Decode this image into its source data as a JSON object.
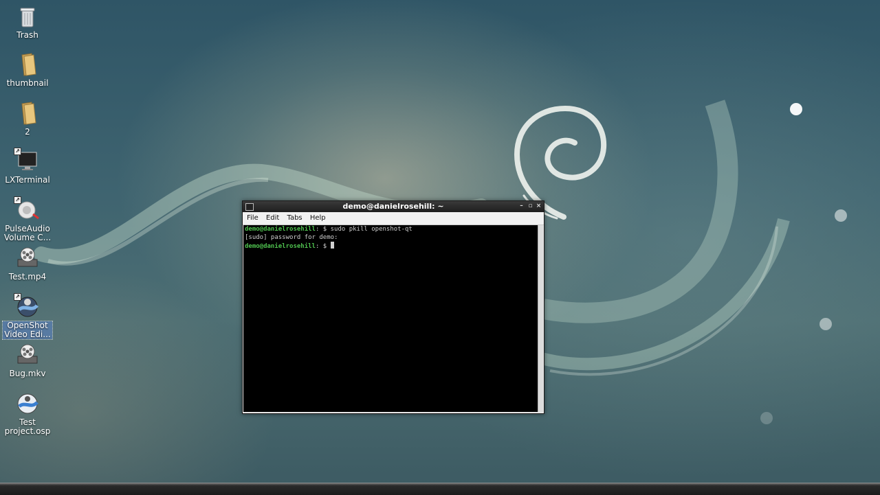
{
  "desktop": {
    "icons": [
      {
        "label": "Trash",
        "icon": "trash-icon"
      },
      {
        "label": "thumbnail",
        "icon": "folder-icon"
      },
      {
        "label": "2",
        "icon": "folder-icon"
      },
      {
        "label": "LXTerminal",
        "icon": "terminal-icon"
      },
      {
        "label": "PulseAudio Volume C...",
        "icon": "audio-icon"
      },
      {
        "label": "Test.mp4",
        "icon": "video-reel-icon"
      },
      {
        "label": "OpenShot Video Edi...",
        "icon": "openshot-icon"
      },
      {
        "label": "Bug.mkv",
        "icon": "video-reel-icon"
      },
      {
        "label": "Test project.osp",
        "icon": "openshot-project-icon"
      }
    ]
  },
  "terminal": {
    "title": "demo@danielrosehill: ~",
    "menu": [
      "File",
      "Edit",
      "Tabs",
      "Help"
    ],
    "lines": [
      {
        "user": "demo@danielrosehill",
        "rest": ": $ sudo pkill openshot-qt"
      },
      {
        "user": "",
        "rest": "[sudo] password for demo:"
      },
      {
        "user": "demo@danielrosehill",
        "rest": ": $ "
      }
    ],
    "buttons": {
      "minimize": "–",
      "maximize": "▫",
      "close": "×"
    }
  },
  "colors": {
    "prompt_green": "#4fc24f",
    "terminal_bg": "#000000",
    "selection": "#5a82c8"
  }
}
